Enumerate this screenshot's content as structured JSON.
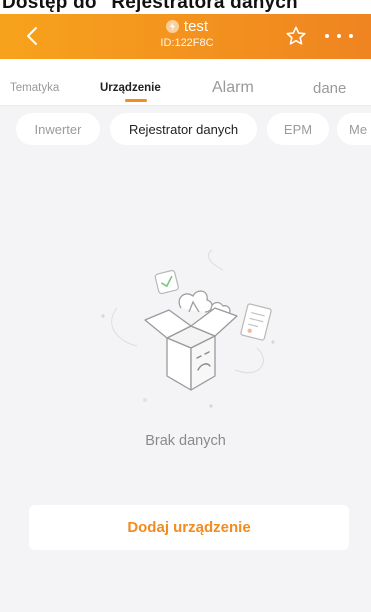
{
  "caption": {
    "text": "Dostęp do \"Rejestratora danych\""
  },
  "header": {
    "title": "test",
    "device_id": "ID:122F8C",
    "icons": {
      "back": "chevron-left-icon",
      "favorite": "star-outline-icon",
      "more": "more-dots-icon",
      "status": "bolt-icon"
    }
  },
  "tabs": [
    {
      "label": "Tematyka"
    },
    {
      "label": "Urządzenie",
      "active": true
    },
    {
      "label": "Alarm"
    },
    {
      "label": "dane"
    }
  ],
  "chips": [
    {
      "label": "Inwerter"
    },
    {
      "label": "Rejestrator danych",
      "selected": true
    },
    {
      "label": "EPM"
    },
    {
      "label": "Me"
    }
  ],
  "empty_state": {
    "text": "Brak danych",
    "icon": "empty-box-icon"
  },
  "add_button": {
    "label": "Dodaj urządzenie"
  },
  "colors": {
    "accent": "#f28c1e",
    "header_start": "#f7a21c",
    "header_end": "#ef8420",
    "background": "#f4f4f6"
  }
}
